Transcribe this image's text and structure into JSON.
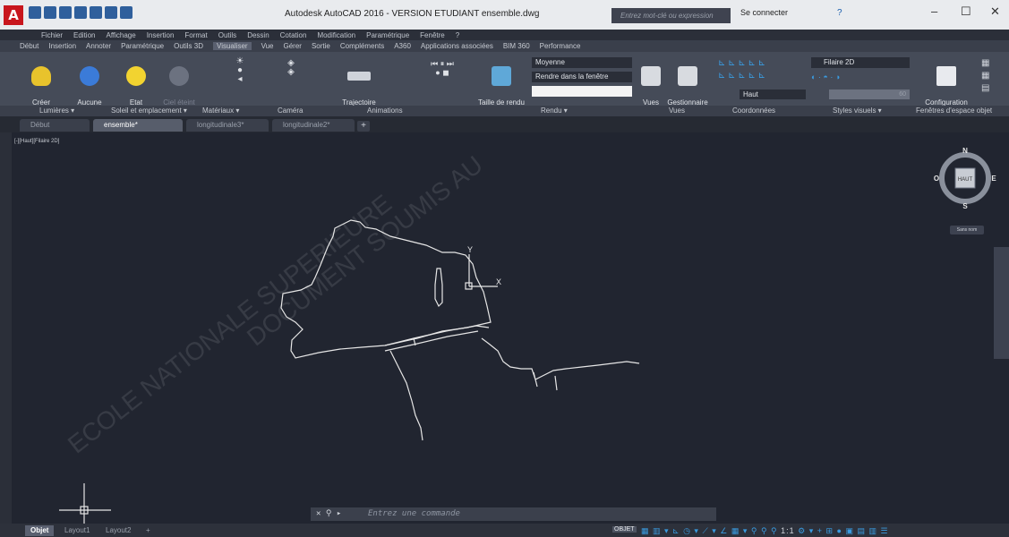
{
  "titlebar": {
    "app_logo": "A",
    "title": "Autodesk AutoCAD 2016 - VERSION ETUDIANT    ensemble.dwg",
    "search_placeholder": "Entrez mot-clé ou expression",
    "signin": "Se connecter",
    "help": "?"
  },
  "menubar": [
    "Fichier",
    "Edition",
    "Affichage",
    "Insertion",
    "Format",
    "Outils",
    "Dessin",
    "Cotation",
    "Modification",
    "Paramétrique",
    "Fenêtre",
    "?"
  ],
  "ribbon_tabs": [
    "Début",
    "Insertion",
    "Annoter",
    "Paramétrique",
    "Outils 3D",
    "Visualiser",
    "Vue",
    "Gérer",
    "Sortie",
    "Compléments",
    "A360",
    "Applications associées",
    "BIM 360",
    "Performance"
  ],
  "ribbon_tabs_active": "Visualiser",
  "ribbon": {
    "create_light": "Créer\nune lumière",
    "no_shadow": "Aucune\nombre",
    "sun_state": "Etat\ndu soleil",
    "sky_off": "Ciel éteint",
    "motion_path": "Trajectoire\ndu mouvement d'animation",
    "render_size": "Taille de rendu",
    "render_quality": "Moyenne",
    "render_in": "Rendre dans la fenêtre",
    "views": "Vues",
    "view_manager": "Gestionnaire\ndes vues",
    "coord_top": "Haut",
    "visual_style": "Filaire 2D",
    "slider_value": "60",
    "viewport_config": "Configuration\nde la fenêtre"
  },
  "panel_labels": [
    "Lumières ▾",
    "Soleil et emplacement ▾",
    "Matériaux ▾",
    "Caméra",
    "Animations",
    "Rendu ▾",
    "Vues",
    "Coordonnées",
    "Styles visuels ▾",
    "Fenêtres d'espace objet"
  ],
  "doc_tabs": [
    "Début",
    "ensemble*",
    "longitudinale3*",
    "longitudinale2*"
  ],
  "doc_tab_active": "ensemble*",
  "viewport": {
    "label": "[-][Haut][Filaire 2D]",
    "compass": {
      "n": "N",
      "s": "S",
      "e": "E",
      "w": "O",
      "face": "HAUT"
    },
    "wcs": "Sans nom",
    "ucs_x": "X",
    "ucs_y": "Y"
  },
  "command": {
    "placeholder": "Entrez une commande"
  },
  "layout_tabs": [
    "Objet",
    "Layout1",
    "Layout2"
  ],
  "layout_tab_active": "Objet",
  "status": {
    "objet": "OBJET",
    "annot_scale": "1:1"
  },
  "watermark": [
    "ECOLE NATIONALE SUPERIEURE",
    "DOCUMENT SOUMIS AU"
  ],
  "colors": {
    "background": "#212530",
    "ribbon": "#454b58",
    "accent": "#3a9be0",
    "logo": "#c8161d",
    "drawing": "#e6e6e6"
  }
}
